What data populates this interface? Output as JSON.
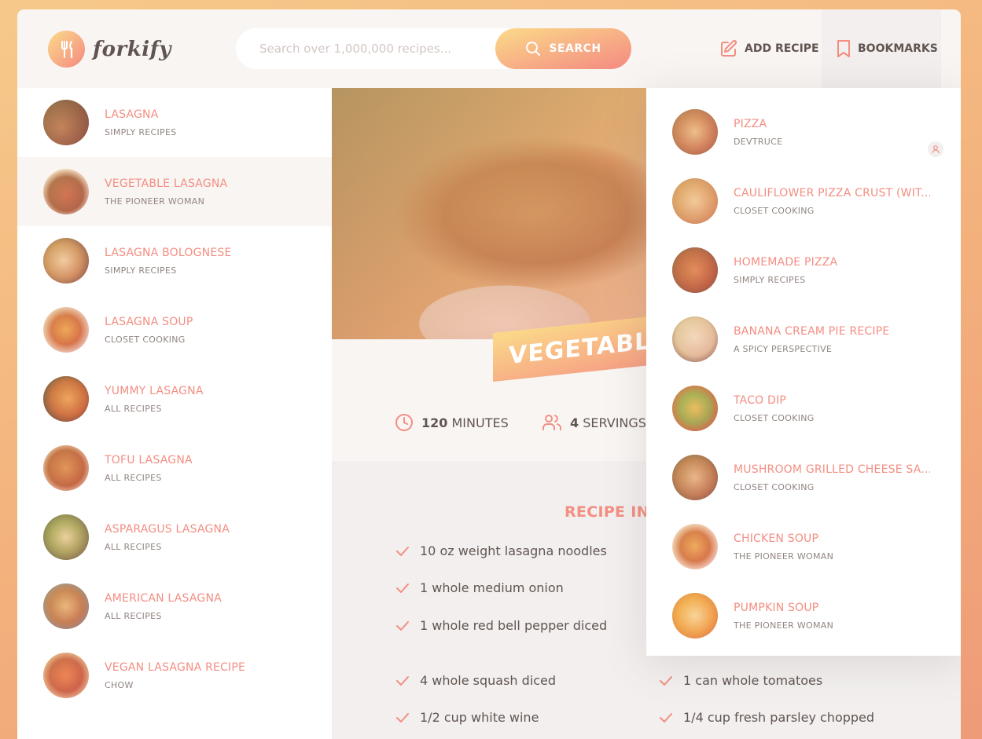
{
  "header": {
    "logo_text": "forkify",
    "search": {
      "placeholder": "Search over 1,000,000 recipes...",
      "button_label": "SEARCH"
    },
    "nav": {
      "add_recipe": "ADD RECIPE",
      "bookmarks": "BOOKMARKS"
    }
  },
  "results": [
    {
      "title": "LASAGNA",
      "publisher": "SIMPLY RECIPES"
    },
    {
      "title": "VEGETABLE LASAGNA",
      "publisher": "THE PIONEER WOMAN",
      "active": true
    },
    {
      "title": "LASAGNA BOLOGNESE",
      "publisher": "SIMPLY RECIPES"
    },
    {
      "title": "LASAGNA SOUP",
      "publisher": "CLOSET COOKING"
    },
    {
      "title": "YUMMY LASAGNA",
      "publisher": "ALL RECIPES"
    },
    {
      "title": "TOFU LASAGNA",
      "publisher": "ALL RECIPES"
    },
    {
      "title": "ASPARAGUS LASAGNA",
      "publisher": "ALL RECIPES"
    },
    {
      "title": "AMERICAN LASAGNA",
      "publisher": "ALL RECIPES"
    },
    {
      "title": "VEGAN LASAGNA RECIPE",
      "publisher": "CHOW"
    }
  ],
  "recipe": {
    "title": "VEGETABLE LASAGNA",
    "cooking_time": "120",
    "cooking_time_unit": "MINUTES",
    "servings": "4",
    "servings_unit": "SERVINGS",
    "ingredients_heading": "RECIPE INGREDIENTS",
    "ingredients": [
      "10 oz weight lasagna noodles",
      "1 whole medium onion",
      "1 whole red bell pepper diced",
      "4 whole squash diced",
      "1/2 cup white wine",
      "1 can whole tomatoes",
      "1/4 cup fresh parsley chopped"
    ]
  },
  "bookmarks": [
    {
      "title": "PIZZA",
      "publisher": "DEVTRUCE",
      "user_generated": true
    },
    {
      "title": "CAULIFLOWER PIZZA CRUST (WIT...",
      "publisher": "CLOSET COOKING"
    },
    {
      "title": "HOMEMADE PIZZA",
      "publisher": "SIMPLY RECIPES"
    },
    {
      "title": "BANANA CREAM PIE RECIPE",
      "publisher": "A SPICY PERSPECTIVE"
    },
    {
      "title": "TACO DIP",
      "publisher": "CLOSET COOKING"
    },
    {
      "title": "MUSHROOM GRILLED CHEESE SA...",
      "publisher": "CLOSET COOKING"
    },
    {
      "title": "CHICKEN SOUP",
      "publisher": "THE PIONEER WOMAN"
    },
    {
      "title": "PUMPKIN SOUP",
      "publisher": "THE PIONEER WOMAN"
    }
  ],
  "colors": {
    "accent": "#f38e82",
    "gradient_start": "#fbdb89",
    "gradient_end": "#f48982",
    "text": "#615551"
  },
  "icons": [
    "fork-knife-logo-icon",
    "search-icon",
    "edit-icon",
    "bookmark-icon",
    "clock-icon",
    "users-icon",
    "check-icon",
    "user-icon"
  ]
}
